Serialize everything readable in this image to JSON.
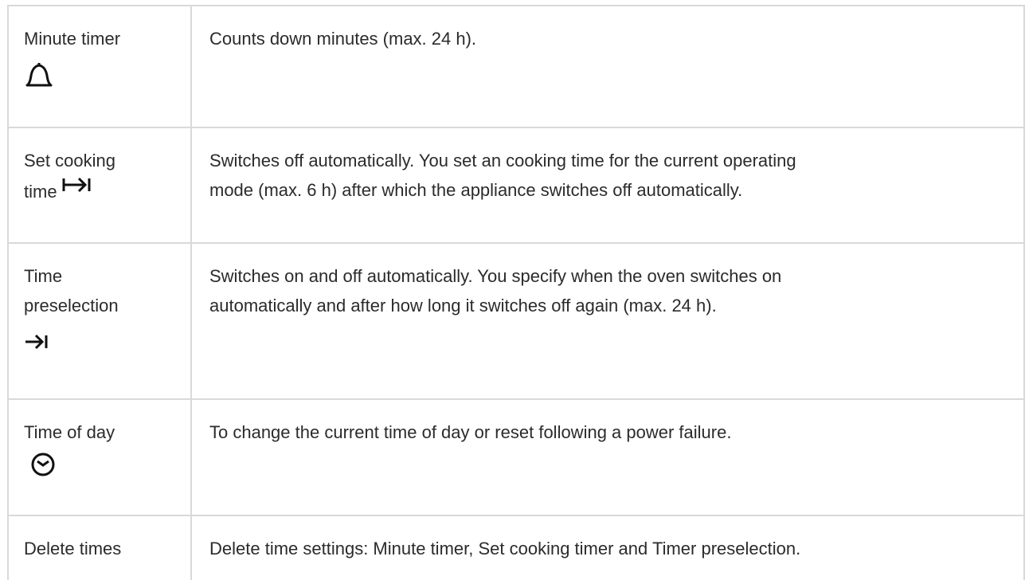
{
  "rows": [
    {
      "term": "Minute timer",
      "icon": "bell-icon",
      "desc": "Counts down minutes (max. 24 h)."
    },
    {
      "term_1": "Set cooking",
      "term_2": "time",
      "icon": "cooking-time-icon",
      "desc_1": "Switches off automatically. You set an cooking time for the current operating",
      "desc_2": "mode (max. 6 h) after which the appliance switches off automatically."
    },
    {
      "term_1": "Time",
      "term_2": "preselection",
      "icon": "preselection-arrow-icon",
      "desc_1": "Switches on and off automatically. You specify when the oven switches on",
      "desc_2": "automatically and after how long it switches off again (max. 24 h)."
    },
    {
      "term": "Time of day",
      "icon": "clock-icon",
      "desc": "To change the current time of day or reset following a power failure."
    },
    {
      "term": "Delete times",
      "desc": "Delete time settings: Minute timer, Set cooking timer and Timer preselection."
    }
  ]
}
